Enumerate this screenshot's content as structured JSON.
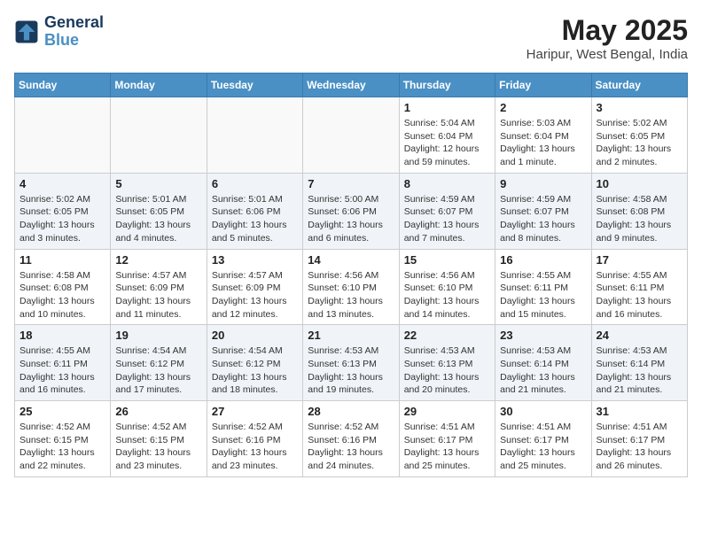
{
  "logo": {
    "line1": "General",
    "line2": "Blue"
  },
  "title": "May 2025",
  "subtitle": "Haripur, West Bengal, India",
  "days_of_week": [
    "Sunday",
    "Monday",
    "Tuesday",
    "Wednesday",
    "Thursday",
    "Friday",
    "Saturday"
  ],
  "weeks": [
    [
      {
        "day": "",
        "info": ""
      },
      {
        "day": "",
        "info": ""
      },
      {
        "day": "",
        "info": ""
      },
      {
        "day": "",
        "info": ""
      },
      {
        "day": "1",
        "info": "Sunrise: 5:04 AM\nSunset: 6:04 PM\nDaylight: 12 hours and 59 minutes."
      },
      {
        "day": "2",
        "info": "Sunrise: 5:03 AM\nSunset: 6:04 PM\nDaylight: 13 hours and 1 minute."
      },
      {
        "day": "3",
        "info": "Sunrise: 5:02 AM\nSunset: 6:05 PM\nDaylight: 13 hours and 2 minutes."
      }
    ],
    [
      {
        "day": "4",
        "info": "Sunrise: 5:02 AM\nSunset: 6:05 PM\nDaylight: 13 hours and 3 minutes."
      },
      {
        "day": "5",
        "info": "Sunrise: 5:01 AM\nSunset: 6:05 PM\nDaylight: 13 hours and 4 minutes."
      },
      {
        "day": "6",
        "info": "Sunrise: 5:01 AM\nSunset: 6:06 PM\nDaylight: 13 hours and 5 minutes."
      },
      {
        "day": "7",
        "info": "Sunrise: 5:00 AM\nSunset: 6:06 PM\nDaylight: 13 hours and 6 minutes."
      },
      {
        "day": "8",
        "info": "Sunrise: 4:59 AM\nSunset: 6:07 PM\nDaylight: 13 hours and 7 minutes."
      },
      {
        "day": "9",
        "info": "Sunrise: 4:59 AM\nSunset: 6:07 PM\nDaylight: 13 hours and 8 minutes."
      },
      {
        "day": "10",
        "info": "Sunrise: 4:58 AM\nSunset: 6:08 PM\nDaylight: 13 hours and 9 minutes."
      }
    ],
    [
      {
        "day": "11",
        "info": "Sunrise: 4:58 AM\nSunset: 6:08 PM\nDaylight: 13 hours and 10 minutes."
      },
      {
        "day": "12",
        "info": "Sunrise: 4:57 AM\nSunset: 6:09 PM\nDaylight: 13 hours and 11 minutes."
      },
      {
        "day": "13",
        "info": "Sunrise: 4:57 AM\nSunset: 6:09 PM\nDaylight: 13 hours and 12 minutes."
      },
      {
        "day": "14",
        "info": "Sunrise: 4:56 AM\nSunset: 6:10 PM\nDaylight: 13 hours and 13 minutes."
      },
      {
        "day": "15",
        "info": "Sunrise: 4:56 AM\nSunset: 6:10 PM\nDaylight: 13 hours and 14 minutes."
      },
      {
        "day": "16",
        "info": "Sunrise: 4:55 AM\nSunset: 6:11 PM\nDaylight: 13 hours and 15 minutes."
      },
      {
        "day": "17",
        "info": "Sunrise: 4:55 AM\nSunset: 6:11 PM\nDaylight: 13 hours and 16 minutes."
      }
    ],
    [
      {
        "day": "18",
        "info": "Sunrise: 4:55 AM\nSunset: 6:11 PM\nDaylight: 13 hours and 16 minutes."
      },
      {
        "day": "19",
        "info": "Sunrise: 4:54 AM\nSunset: 6:12 PM\nDaylight: 13 hours and 17 minutes."
      },
      {
        "day": "20",
        "info": "Sunrise: 4:54 AM\nSunset: 6:12 PM\nDaylight: 13 hours and 18 minutes."
      },
      {
        "day": "21",
        "info": "Sunrise: 4:53 AM\nSunset: 6:13 PM\nDaylight: 13 hours and 19 minutes."
      },
      {
        "day": "22",
        "info": "Sunrise: 4:53 AM\nSunset: 6:13 PM\nDaylight: 13 hours and 20 minutes."
      },
      {
        "day": "23",
        "info": "Sunrise: 4:53 AM\nSunset: 6:14 PM\nDaylight: 13 hours and 21 minutes."
      },
      {
        "day": "24",
        "info": "Sunrise: 4:53 AM\nSunset: 6:14 PM\nDaylight: 13 hours and 21 minutes."
      }
    ],
    [
      {
        "day": "25",
        "info": "Sunrise: 4:52 AM\nSunset: 6:15 PM\nDaylight: 13 hours and 22 minutes."
      },
      {
        "day": "26",
        "info": "Sunrise: 4:52 AM\nSunset: 6:15 PM\nDaylight: 13 hours and 23 minutes."
      },
      {
        "day": "27",
        "info": "Sunrise: 4:52 AM\nSunset: 6:16 PM\nDaylight: 13 hours and 23 minutes."
      },
      {
        "day": "28",
        "info": "Sunrise: 4:52 AM\nSunset: 6:16 PM\nDaylight: 13 hours and 24 minutes."
      },
      {
        "day": "29",
        "info": "Sunrise: 4:51 AM\nSunset: 6:17 PM\nDaylight: 13 hours and 25 minutes."
      },
      {
        "day": "30",
        "info": "Sunrise: 4:51 AM\nSunset: 6:17 PM\nDaylight: 13 hours and 25 minutes."
      },
      {
        "day": "31",
        "info": "Sunrise: 4:51 AM\nSunset: 6:17 PM\nDaylight: 13 hours and 26 minutes."
      }
    ]
  ]
}
